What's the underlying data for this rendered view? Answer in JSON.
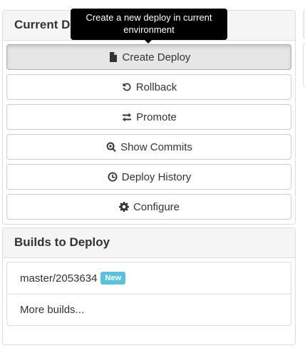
{
  "current_deploy": {
    "heading": "Current Deploy",
    "buttons": [
      {
        "label": "Create Deploy",
        "icon": "file-icon"
      },
      {
        "label": "Rollback",
        "icon": "rollback-icon"
      },
      {
        "label": "Promote",
        "icon": "promote-arrows-icon"
      },
      {
        "label": "Show Commits",
        "icon": "search-zoom-icon"
      },
      {
        "label": "Deploy History",
        "icon": "clock-icon"
      },
      {
        "label": "Configure",
        "icon": "gear-icon"
      }
    ]
  },
  "tooltip": {
    "text": "Create a new deploy in current environment"
  },
  "builds": {
    "heading": "Builds to Deploy",
    "items": [
      {
        "label": "master/2053634",
        "badge": "New"
      },
      {
        "label": "More builds..."
      }
    ]
  },
  "colors": {
    "badge_new": "#5bc0de",
    "panel_heading_bg": "#f5f5f5",
    "active_button_bg": "#e6e6e6",
    "tooltip_bg": "#000000"
  }
}
